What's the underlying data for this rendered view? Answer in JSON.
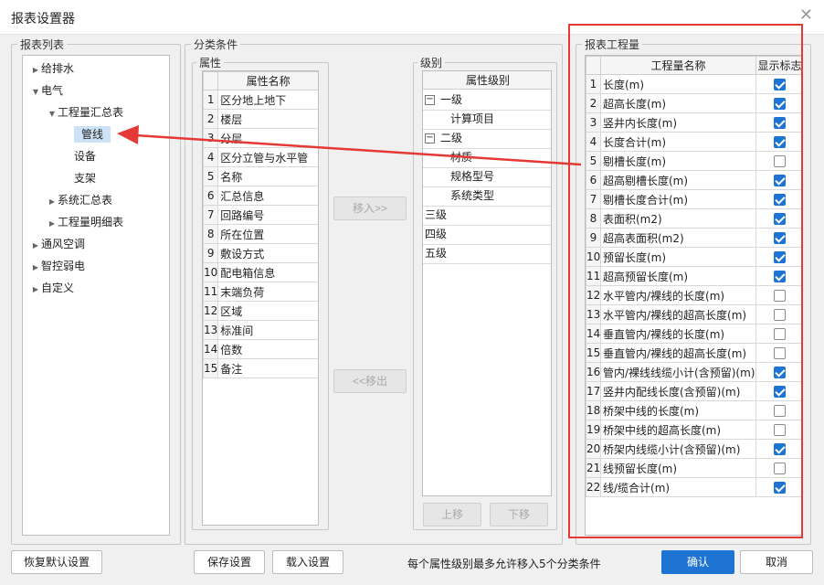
{
  "window": {
    "title": "报表设置器"
  },
  "report_list": {
    "legend": "报表列表",
    "tree": [
      {
        "label": "给排水",
        "arrow": "▶",
        "level": 0
      },
      {
        "label": "电气",
        "arrow": "▼",
        "level": 0
      },
      {
        "label": "工程量汇总表",
        "arrow": "▼",
        "level": 1
      },
      {
        "label": "管线",
        "arrow": "",
        "level": 2,
        "selected": true
      },
      {
        "label": "设备",
        "arrow": "",
        "level": 2
      },
      {
        "label": "支架",
        "arrow": "",
        "level": 2
      },
      {
        "label": "系统汇总表",
        "arrow": "▶",
        "level": 1
      },
      {
        "label": "工程量明细表",
        "arrow": "▶",
        "level": 1
      },
      {
        "label": "通风空调",
        "arrow": "▶",
        "level": 0
      },
      {
        "label": "智控弱电",
        "arrow": "▶",
        "level": 0
      },
      {
        "label": "自定义",
        "arrow": "▶",
        "level": 0
      }
    ]
  },
  "classification": {
    "legend": "分类条件",
    "attributes": {
      "legend": "属性",
      "header": "属性名称",
      "rows": [
        "区分地上地下",
        "楼层",
        "分层",
        "区分立管与水平管",
        "名称",
        "汇总信息",
        "回路编号",
        "所在位置",
        "敷设方式",
        "配电箱信息",
        "末端负荷",
        "区域",
        "标准间",
        "倍数",
        "备注"
      ]
    },
    "move_in_label": "移入>>",
    "move_out_label": "<<移出",
    "levels": {
      "legend": "级别",
      "header": "属性级别",
      "level1": "一级",
      "level1_children": [
        "计算项目"
      ],
      "level2": "二级",
      "level2_children": [
        "材质",
        "规格型号",
        "系统类型"
      ],
      "others": [
        "三级",
        "四级",
        "五级"
      ],
      "move_up_label": "上移",
      "move_down_label": "下移"
    }
  },
  "quantities": {
    "legend": "报表工程量",
    "header_name": "工程量名称",
    "header_show": "显示标志",
    "rows": [
      {
        "name": "长度(m)",
        "checked": true
      },
      {
        "name": "超高长度(m)",
        "checked": true
      },
      {
        "name": "竖井内长度(m)",
        "checked": true
      },
      {
        "name": "长度合计(m)",
        "checked": true
      },
      {
        "name": "剔槽长度(m)",
        "checked": false
      },
      {
        "name": "超高剔槽长度(m)",
        "checked": true
      },
      {
        "name": "剔槽长度合计(m)",
        "checked": true
      },
      {
        "name": "表面积(m2)",
        "checked": true
      },
      {
        "name": "超高表面积(m2)",
        "checked": true
      },
      {
        "name": "预留长度(m)",
        "checked": true
      },
      {
        "name": "超高预留长度(m)",
        "checked": true
      },
      {
        "name": "水平管内/裸线的长度(m)",
        "checked": false
      },
      {
        "name": "水平管内/裸线的超高长度(m)",
        "checked": false
      },
      {
        "name": "垂直管内/裸线的长度(m)",
        "checked": false
      },
      {
        "name": "垂直管内/裸线的超高长度(m)",
        "checked": false
      },
      {
        "name": "管内/裸线线缆小计(含预留)(m)",
        "checked": true
      },
      {
        "name": "竖井内配线长度(含预留)(m)",
        "checked": true
      },
      {
        "name": "桥架中线的长度(m)",
        "checked": false
      },
      {
        "name": "桥架中线的超高长度(m)",
        "checked": false
      },
      {
        "name": "桥架内线缆小计(含预留)(m)",
        "checked": true
      },
      {
        "name": "线预留长度(m)",
        "checked": false
      },
      {
        "name": "线/缆合计(m)",
        "checked": true
      }
    ]
  },
  "footer": {
    "restore_label": "恢复默认设置",
    "save_label": "保存设置",
    "load_label": "载入设置",
    "note": "每个属性级别最多允许移入5个分类条件",
    "ok_label": "确认",
    "cancel_label": "取消"
  },
  "colors": {
    "accent": "#1e74d2",
    "annotation": "#e53935",
    "selection": "#cce3f7"
  }
}
